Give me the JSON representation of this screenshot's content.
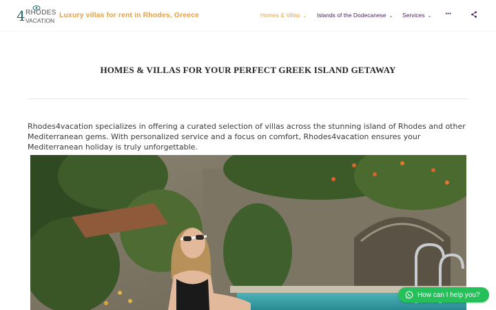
{
  "brand": {
    "logo_number": "4",
    "logo_word1": "RHODES",
    "logo_word2": "VACATION",
    "tagline": "Luxury villas for rent in Rhodes, Greece",
    "accent_color": "#e0a24a",
    "nav_color": "#4a1f5e"
  },
  "nav": {
    "items": [
      {
        "label": "Homes & Villas",
        "active": true
      },
      {
        "label": "Islands of the Dodecanese",
        "active": false
      },
      {
        "label": "Services",
        "active": false
      }
    ],
    "more_icon": "ellipsis-icon",
    "share_icon": "share-icon"
  },
  "main": {
    "heading": "HOMES & VILLAS FOR YOUR PERFECT GREEK ISLAND GETAWAY",
    "intro": "Rhodes4vacation specializes in offering a curated selection of villas across the stunning island of Rhodes and other Mediterranean gems. With personalized service and a focus on comfort, Rhodes4vacation ensures your Mediterranean holiday is truly unforgettable."
  },
  "whatsapp": {
    "label": "How can I help you?",
    "color": "#25c05a",
    "icon": "whatsapp-icon"
  }
}
